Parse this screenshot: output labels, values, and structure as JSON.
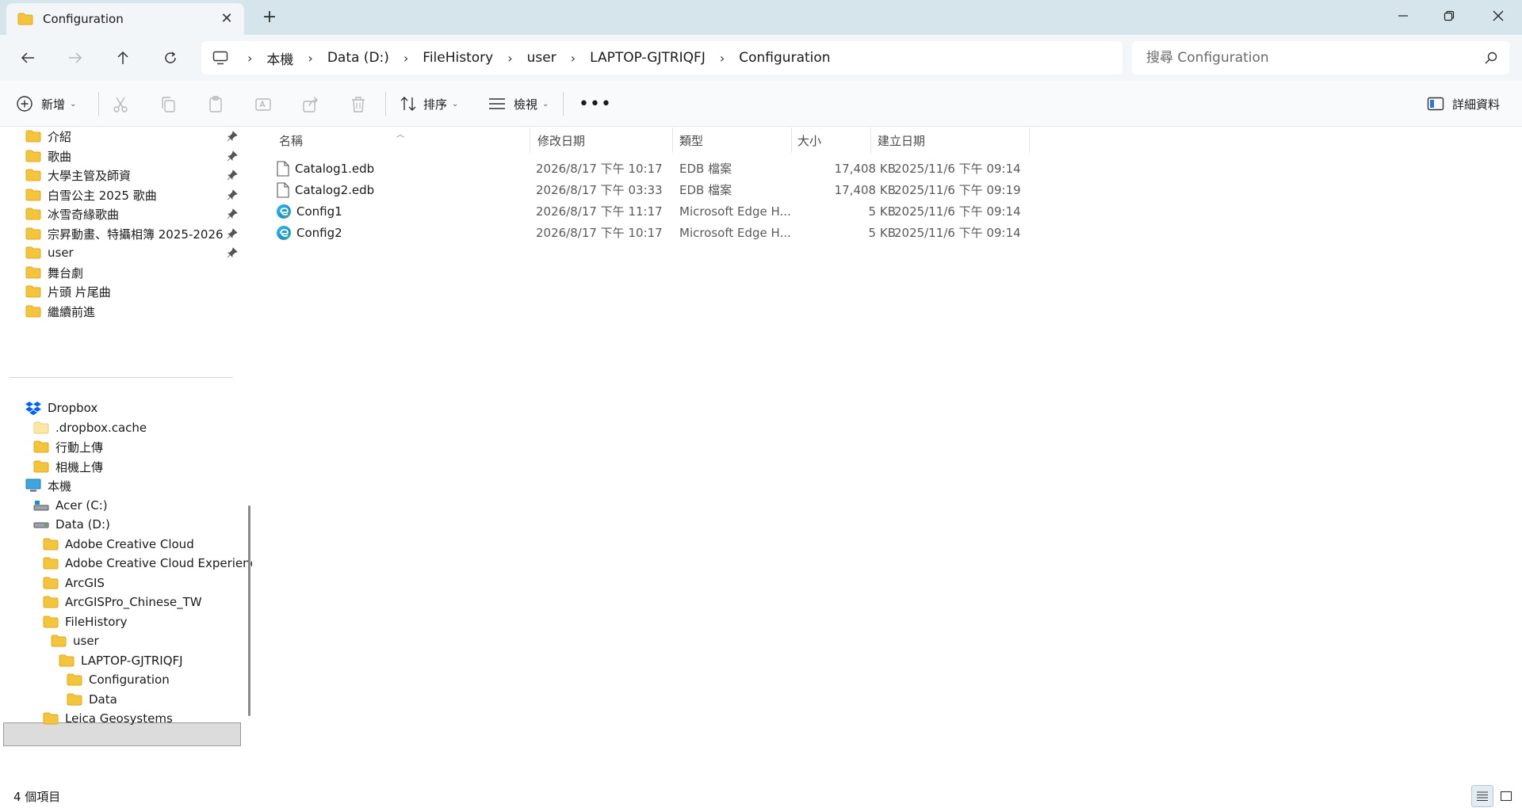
{
  "window": {
    "tab_title": "Configuration",
    "new_tab_symbol": "+",
    "close_symbol": "✕"
  },
  "address": {
    "crumbs": [
      "本機",
      "Data (D:)",
      "FileHistory",
      "user",
      "LAPTOP-GJTRIQFJ",
      "Configuration"
    ]
  },
  "search": {
    "placeholder": "搜尋 Configuration"
  },
  "toolbar": {
    "new_label": "新增",
    "sort_label": "排序",
    "view_label": "檢視",
    "more_label": "•••",
    "details_label": "詳細資料"
  },
  "sidebar": {
    "quick_access": [
      {
        "label": "介紹",
        "pinned": true
      },
      {
        "label": "歌曲",
        "pinned": true
      },
      {
        "label": "大學主管及師資",
        "pinned": true
      },
      {
        "label": "白雪公主 2025 歌曲",
        "pinned": true
      },
      {
        "label": "冰雪奇緣歌曲",
        "pinned": true
      },
      {
        "label": "宗昇動畫、特攝相簿 2025-2026",
        "pinned": true
      },
      {
        "label": "user",
        "pinned": true
      },
      {
        "label": "舞台劇",
        "pinned": false
      },
      {
        "label": "片頭 片尾曲",
        "pinned": false
      },
      {
        "label": "繼續前進",
        "pinned": false
      }
    ],
    "tree": [
      {
        "label": "Dropbox",
        "icon": "dropbox-icon",
        "depth": 0
      },
      {
        "label": ".dropbox.cache",
        "icon": "folder-icon",
        "depth": 1,
        "faded": true
      },
      {
        "label": "行動上傳",
        "icon": "folder-icon",
        "depth": 1
      },
      {
        "label": "相機上傳",
        "icon": "folder-icon",
        "depth": 1
      },
      {
        "label": "本機",
        "icon": "computer-icon",
        "depth": 0
      },
      {
        "label": "Acer (C:)",
        "icon": "drive-icon",
        "depth": 1
      },
      {
        "label": "Data (D:)",
        "icon": "drive-icon",
        "depth": 1
      },
      {
        "label": "Adobe Creative Cloud",
        "icon": "folder-icon",
        "depth": 2
      },
      {
        "label": "Adobe Creative Cloud Experience",
        "icon": "folder-icon",
        "depth": 2
      },
      {
        "label": "ArcGIS",
        "icon": "folder-icon",
        "depth": 2
      },
      {
        "label": "ArcGISPro_Chinese_TW",
        "icon": "folder-icon",
        "depth": 2
      },
      {
        "label": "FileHistory",
        "icon": "folder-icon",
        "depth": 2
      },
      {
        "label": "user",
        "icon": "folder-icon",
        "depth": 3
      },
      {
        "label": "LAPTOP-GJTRIQFJ",
        "icon": "folder-icon",
        "depth": 4
      },
      {
        "label": "Configuration",
        "icon": "folder-icon",
        "depth": 5,
        "selected": true
      },
      {
        "label": "Data",
        "icon": "folder-icon",
        "depth": 5
      },
      {
        "label": "Leica Geosystems",
        "icon": "folder-icon",
        "depth": 2
      }
    ]
  },
  "columns": {
    "name": "名稱",
    "modified": "修改日期",
    "type": "類型",
    "size": "大小",
    "created": "建立日期"
  },
  "files": [
    {
      "name": "Catalog1.edb",
      "icon": "file-icon",
      "modified": "2026/8/17 下午 10:17",
      "type": "EDB 檔案",
      "size": "17,408 KB",
      "created": "2025/11/6 下午 09:14"
    },
    {
      "name": "Catalog2.edb",
      "icon": "file-icon",
      "modified": "2026/8/17 下午 03:33",
      "type": "EDB 檔案",
      "size": "17,408 KB",
      "created": "2025/11/6 下午 09:19"
    },
    {
      "name": "Config1",
      "icon": "edge-icon",
      "modified": "2026/8/17 下午 11:17",
      "type": "Microsoft Edge H...",
      "size": "5 KB",
      "created": "2025/11/6 下午 09:14"
    },
    {
      "name": "Config2",
      "icon": "edge-icon",
      "modified": "2026/8/17 下午 10:17",
      "type": "Microsoft Edge H...",
      "size": "5 KB",
      "created": "2025/11/6 下午 09:14"
    }
  ],
  "status": {
    "item_count": "4 個項目"
  },
  "colors": {
    "folder": "#f4c53a",
    "folder_dark": "#e0a820",
    "titlebar": "#d6e4ec",
    "selected": "#dcdcdc"
  }
}
